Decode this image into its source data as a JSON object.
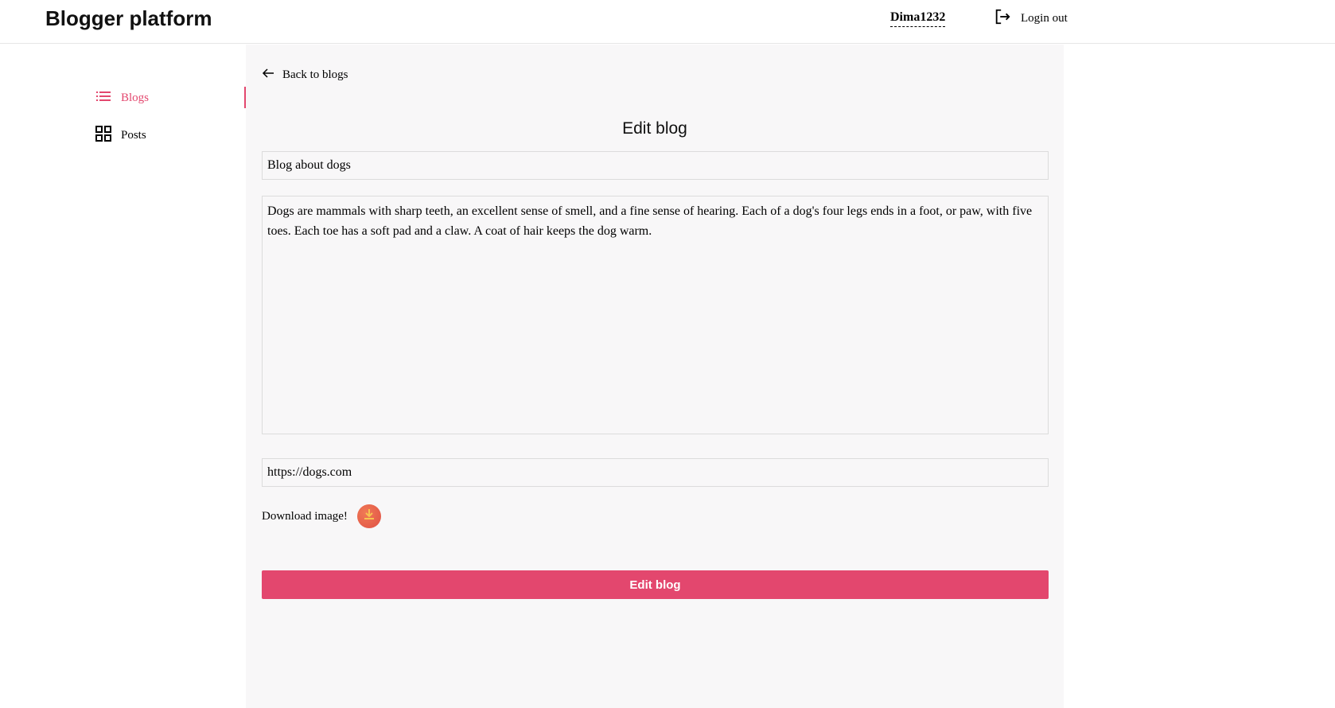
{
  "header": {
    "logo": "Blogger platform",
    "username": "Dima1232",
    "logout_label": "Login out"
  },
  "sidebar": {
    "items": [
      {
        "label": "Blogs",
        "icon": "list-icon",
        "active": true
      },
      {
        "label": "Posts",
        "icon": "grid-icon",
        "active": false
      }
    ]
  },
  "main": {
    "back_label": "Back to blogs",
    "title": "Edit blog",
    "form": {
      "name_value": "Blog about dogs",
      "description_value": "Dogs are mammals with sharp teeth, an excellent sense of smell, and a fine sense of hearing. Each of a dog's four legs ends in a foot, or paw, with five toes. Each toe has a soft pad and a claw. A coat of hair keeps the dog warm.",
      "url_value": "https://dogs.com",
      "download_label": "Download image!",
      "submit_label": "Edit blog"
    }
  },
  "colors": {
    "accent": "#e3476e",
    "main_bg": "#f8f7f8",
    "download_button": "#e9604a"
  }
}
